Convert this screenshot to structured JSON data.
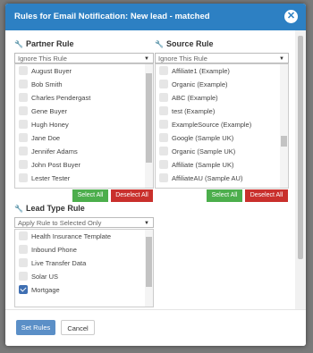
{
  "dialog": {
    "title": "Rules for Email Notification: New lead - matched",
    "close_icon": "close-icon"
  },
  "partner_rule": {
    "title": "Partner Rule",
    "select_value": "Ignore This Rule",
    "items": [
      "August Buyer",
      "Bob Smith",
      "Charles Pendergast",
      "Gene Buyer",
      "Hugh Honey",
      "Jane Doe",
      "Jennifer Adams",
      "John Post Buyer",
      "Lester Tester"
    ],
    "select_all": "Select All",
    "deselect_all": "Deselect All"
  },
  "source_rule": {
    "title": "Source Rule",
    "select_value": "Ignore This Rule",
    "items": [
      "Affiliate1 (Example)",
      "Organic (Example)",
      "ABC (Example)",
      "test (Example)",
      "ExampleSource (Example)",
      "Google (Sample UK)",
      "Organic (Sample UK)",
      "Affiliate (Sample UK)",
      "AffiliateAU (Sample AU)"
    ],
    "select_all": "Select All",
    "deselect_all": "Deselect All"
  },
  "lead_type_rule": {
    "title": "Lead Type Rule",
    "select_value": "Apply Rule to Selected Only",
    "items": [
      {
        "label": "Health Insurance Template",
        "checked": false
      },
      {
        "label": "Inbound Phone",
        "checked": false
      },
      {
        "label": "Live Transfer Data",
        "checked": false
      },
      {
        "label": "Solar US",
        "checked": false
      },
      {
        "label": "Mortgage",
        "checked": true
      }
    ]
  },
  "footer": {
    "set_rules": "Set Rules",
    "cancel": "Cancel"
  },
  "colors": {
    "header": "#2d80c3",
    "green": "#4cae4c",
    "red": "#c9302c",
    "primary": "#5b8fc7",
    "check": "#3f6fb2"
  }
}
